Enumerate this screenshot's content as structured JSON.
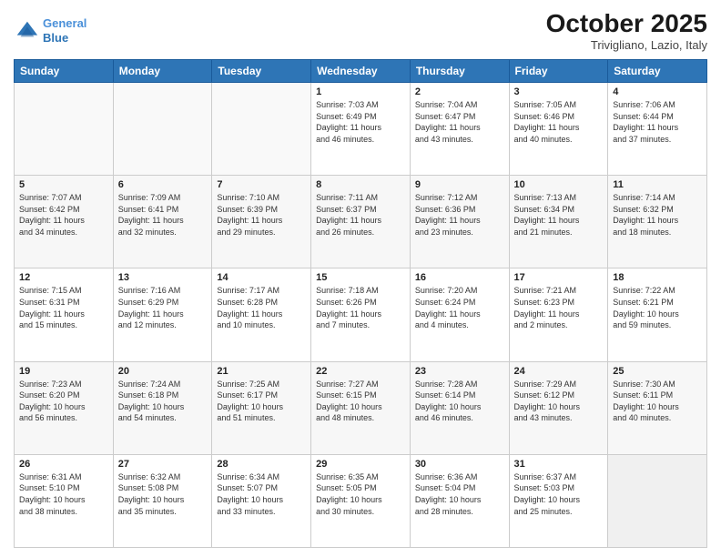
{
  "header": {
    "logo_line1": "General",
    "logo_line2": "Blue",
    "month": "October 2025",
    "location": "Trivigliano, Lazio, Italy"
  },
  "weekdays": [
    "Sunday",
    "Monday",
    "Tuesday",
    "Wednesday",
    "Thursday",
    "Friday",
    "Saturday"
  ],
  "weeks": [
    [
      {
        "day": "",
        "info": ""
      },
      {
        "day": "",
        "info": ""
      },
      {
        "day": "",
        "info": ""
      },
      {
        "day": "1",
        "info": "Sunrise: 7:03 AM\nSunset: 6:49 PM\nDaylight: 11 hours\nand 46 minutes."
      },
      {
        "day": "2",
        "info": "Sunrise: 7:04 AM\nSunset: 6:47 PM\nDaylight: 11 hours\nand 43 minutes."
      },
      {
        "day": "3",
        "info": "Sunrise: 7:05 AM\nSunset: 6:46 PM\nDaylight: 11 hours\nand 40 minutes."
      },
      {
        "day": "4",
        "info": "Sunrise: 7:06 AM\nSunset: 6:44 PM\nDaylight: 11 hours\nand 37 minutes."
      }
    ],
    [
      {
        "day": "5",
        "info": "Sunrise: 7:07 AM\nSunset: 6:42 PM\nDaylight: 11 hours\nand 34 minutes."
      },
      {
        "day": "6",
        "info": "Sunrise: 7:09 AM\nSunset: 6:41 PM\nDaylight: 11 hours\nand 32 minutes."
      },
      {
        "day": "7",
        "info": "Sunrise: 7:10 AM\nSunset: 6:39 PM\nDaylight: 11 hours\nand 29 minutes."
      },
      {
        "day": "8",
        "info": "Sunrise: 7:11 AM\nSunset: 6:37 PM\nDaylight: 11 hours\nand 26 minutes."
      },
      {
        "day": "9",
        "info": "Sunrise: 7:12 AM\nSunset: 6:36 PM\nDaylight: 11 hours\nand 23 minutes."
      },
      {
        "day": "10",
        "info": "Sunrise: 7:13 AM\nSunset: 6:34 PM\nDaylight: 11 hours\nand 21 minutes."
      },
      {
        "day": "11",
        "info": "Sunrise: 7:14 AM\nSunset: 6:32 PM\nDaylight: 11 hours\nand 18 minutes."
      }
    ],
    [
      {
        "day": "12",
        "info": "Sunrise: 7:15 AM\nSunset: 6:31 PM\nDaylight: 11 hours\nand 15 minutes."
      },
      {
        "day": "13",
        "info": "Sunrise: 7:16 AM\nSunset: 6:29 PM\nDaylight: 11 hours\nand 12 minutes."
      },
      {
        "day": "14",
        "info": "Sunrise: 7:17 AM\nSunset: 6:28 PM\nDaylight: 11 hours\nand 10 minutes."
      },
      {
        "day": "15",
        "info": "Sunrise: 7:18 AM\nSunset: 6:26 PM\nDaylight: 11 hours\nand 7 minutes."
      },
      {
        "day": "16",
        "info": "Sunrise: 7:20 AM\nSunset: 6:24 PM\nDaylight: 11 hours\nand 4 minutes."
      },
      {
        "day": "17",
        "info": "Sunrise: 7:21 AM\nSunset: 6:23 PM\nDaylight: 11 hours\nand 2 minutes."
      },
      {
        "day": "18",
        "info": "Sunrise: 7:22 AM\nSunset: 6:21 PM\nDaylight: 10 hours\nand 59 minutes."
      }
    ],
    [
      {
        "day": "19",
        "info": "Sunrise: 7:23 AM\nSunset: 6:20 PM\nDaylight: 10 hours\nand 56 minutes."
      },
      {
        "day": "20",
        "info": "Sunrise: 7:24 AM\nSunset: 6:18 PM\nDaylight: 10 hours\nand 54 minutes."
      },
      {
        "day": "21",
        "info": "Sunrise: 7:25 AM\nSunset: 6:17 PM\nDaylight: 10 hours\nand 51 minutes."
      },
      {
        "day": "22",
        "info": "Sunrise: 7:27 AM\nSunset: 6:15 PM\nDaylight: 10 hours\nand 48 minutes."
      },
      {
        "day": "23",
        "info": "Sunrise: 7:28 AM\nSunset: 6:14 PM\nDaylight: 10 hours\nand 46 minutes."
      },
      {
        "day": "24",
        "info": "Sunrise: 7:29 AM\nSunset: 6:12 PM\nDaylight: 10 hours\nand 43 minutes."
      },
      {
        "day": "25",
        "info": "Sunrise: 7:30 AM\nSunset: 6:11 PM\nDaylight: 10 hours\nand 40 minutes."
      }
    ],
    [
      {
        "day": "26",
        "info": "Sunrise: 6:31 AM\nSunset: 5:10 PM\nDaylight: 10 hours\nand 38 minutes."
      },
      {
        "day": "27",
        "info": "Sunrise: 6:32 AM\nSunset: 5:08 PM\nDaylight: 10 hours\nand 35 minutes."
      },
      {
        "day": "28",
        "info": "Sunrise: 6:34 AM\nSunset: 5:07 PM\nDaylight: 10 hours\nand 33 minutes."
      },
      {
        "day": "29",
        "info": "Sunrise: 6:35 AM\nSunset: 5:05 PM\nDaylight: 10 hours\nand 30 minutes."
      },
      {
        "day": "30",
        "info": "Sunrise: 6:36 AM\nSunset: 5:04 PM\nDaylight: 10 hours\nand 28 minutes."
      },
      {
        "day": "31",
        "info": "Sunrise: 6:37 AM\nSunset: 5:03 PM\nDaylight: 10 hours\nand 25 minutes."
      },
      {
        "day": "",
        "info": ""
      }
    ]
  ]
}
